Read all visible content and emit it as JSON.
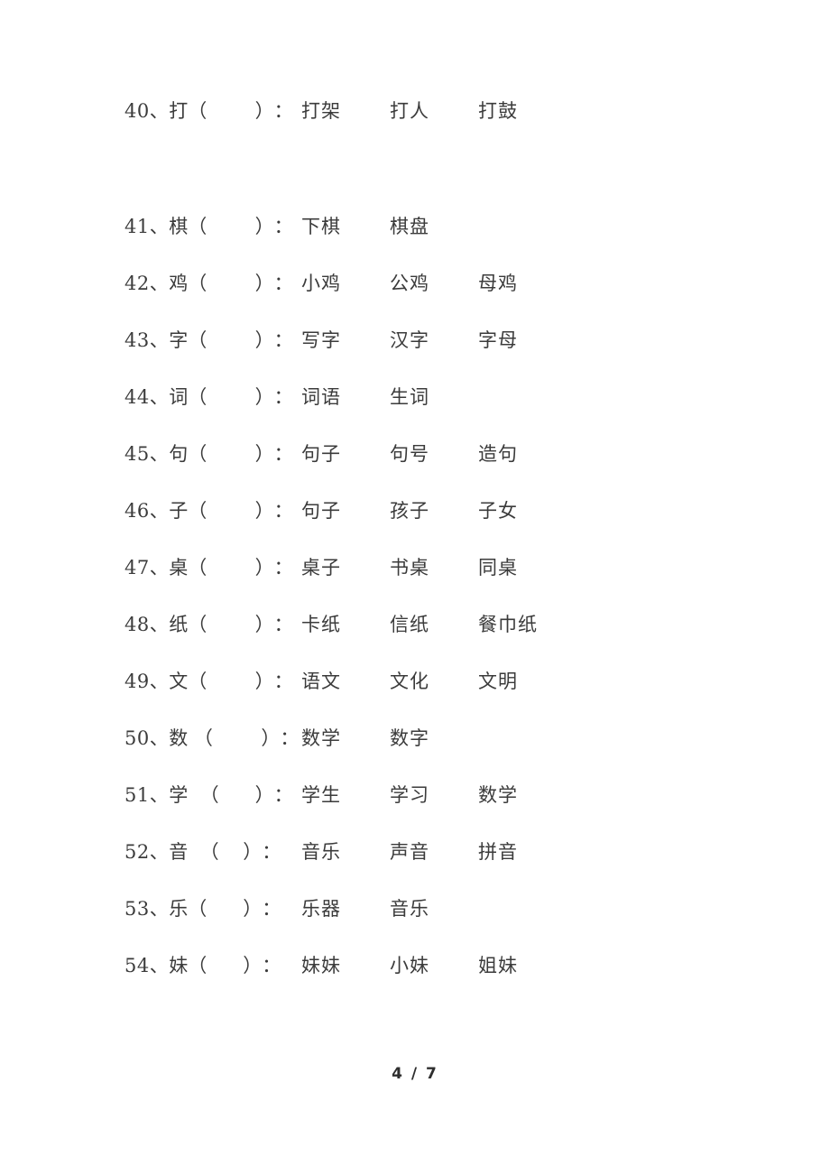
{
  "document": {
    "footer_page_label": "4 / 7"
  },
  "rows": [
    {
      "index": "40、",
      "char": "打",
      "open_paren": "（",
      "blank": "        ",
      "close_paren": "）",
      "colon": "：",
      "words": [
        "打架",
        "打人",
        "打鼓"
      ],
      "extra_gap_after": true
    },
    {
      "index": "41、",
      "char": "棋",
      "open_paren": "（",
      "blank": "        ",
      "close_paren": "）",
      "colon": "：",
      "words": [
        "下棋",
        "棋盘",
        ""
      ],
      "extra_gap_after": false
    },
    {
      "index": "42、",
      "char": "鸡",
      "open_paren": "（",
      "blank": "        ",
      "close_paren": "）",
      "colon": "：",
      "words": [
        "小鸡",
        "公鸡",
        "母鸡"
      ],
      "extra_gap_after": false
    },
    {
      "index": "43、",
      "char": "字",
      "open_paren": "（",
      "blank": "        ",
      "close_paren": "）",
      "colon": "：",
      "words": [
        "写字",
        "汉字",
        "字母"
      ],
      "extra_gap_after": false
    },
    {
      "index": "44、",
      "char": "词",
      "open_paren": "（",
      "blank": "        ",
      "close_paren": "）",
      "colon": "：",
      "words": [
        "词语",
        "生词",
        ""
      ],
      "extra_gap_after": false
    },
    {
      "index": "45、",
      "char": "句",
      "open_paren": "（",
      "blank": "        ",
      "close_paren": "）",
      "colon": "：",
      "words": [
        "句子",
        "句号",
        "造句"
      ],
      "extra_gap_after": false
    },
    {
      "index": "46、",
      "char": "子",
      "open_paren": "（",
      "blank": "        ",
      "close_paren": "）",
      "colon": "：",
      "words": [
        "句子",
        "孩子",
        "子女"
      ],
      "extra_gap_after": false
    },
    {
      "index": "47、",
      "char": "桌",
      "open_paren": "（",
      "blank": "        ",
      "close_paren": "）",
      "colon": "：",
      "words": [
        "桌子",
        "书桌",
        "同桌"
      ],
      "extra_gap_after": false
    },
    {
      "index": "48、",
      "char": "纸",
      "open_paren": "（",
      "blank": "        ",
      "close_paren": "）",
      "colon": "：",
      "words": [
        "卡纸",
        "信纸",
        "餐巾纸"
      ],
      "extra_gap_after": false
    },
    {
      "index": "49、",
      "char": "文",
      "open_paren": "（",
      "blank": "        ",
      "close_paren": "）",
      "colon": "：",
      "words": [
        "语文",
        "文化",
        " 文明"
      ],
      "extra_gap_after": false
    },
    {
      "index": "50、",
      "char": "数",
      "open_paren": " （",
      "blank": "        ",
      "close_paren": "）",
      "colon": "：",
      "words": [
        "数学",
        "数字",
        ""
      ],
      "extra_gap_after": false
    },
    {
      "index": "51、",
      "char": "学",
      "open_paren": "  （",
      "blank": "      ",
      "close_paren": "）",
      "colon": "：",
      "words": [
        "学生",
        "学习",
        "数学"
      ],
      "extra_gap_after": false
    },
    {
      "index": "52、",
      "char": "音",
      "open_paren": "  （",
      "blank": "    ",
      "close_paren": "）",
      "colon": "：",
      "words": [
        "音乐",
        "声音",
        "拼音"
      ],
      "extra_gap_after": false
    },
    {
      "index": "53、",
      "char": "乐",
      "open_paren": "（",
      "blank": "      ",
      "close_paren": "）",
      "colon": "：",
      "words": [
        "乐器",
        "音乐",
        ""
      ],
      "extra_gap_after": false
    },
    {
      "index": "54、",
      "char": "妹",
      "open_paren": "（",
      "blank": "      ",
      "close_paren": "）",
      "colon": "：",
      "words": [
        "妹妹",
        " 小妹",
        " 姐妹"
      ],
      "extra_gap_after": false
    }
  ]
}
